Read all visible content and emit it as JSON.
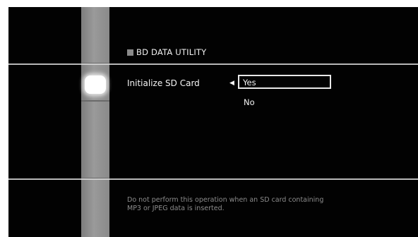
{
  "header": {
    "title": "BD DATA UTILITY"
  },
  "setting": {
    "label": "Initialize SD Card",
    "arrow_icon": "◀",
    "options": [
      {
        "label": "Yes",
        "selected": true
      },
      {
        "label": "No",
        "selected": false
      }
    ]
  },
  "footer": {
    "line1": "Do not perform this operation when an SD card containing",
    "line2": "MP3 or JPEG data is inserted."
  },
  "colors": {
    "background": "#020202",
    "text": "#f5f5f5",
    "muted_text": "#8c8c8c",
    "side_bar": "#8a8a8a"
  }
}
